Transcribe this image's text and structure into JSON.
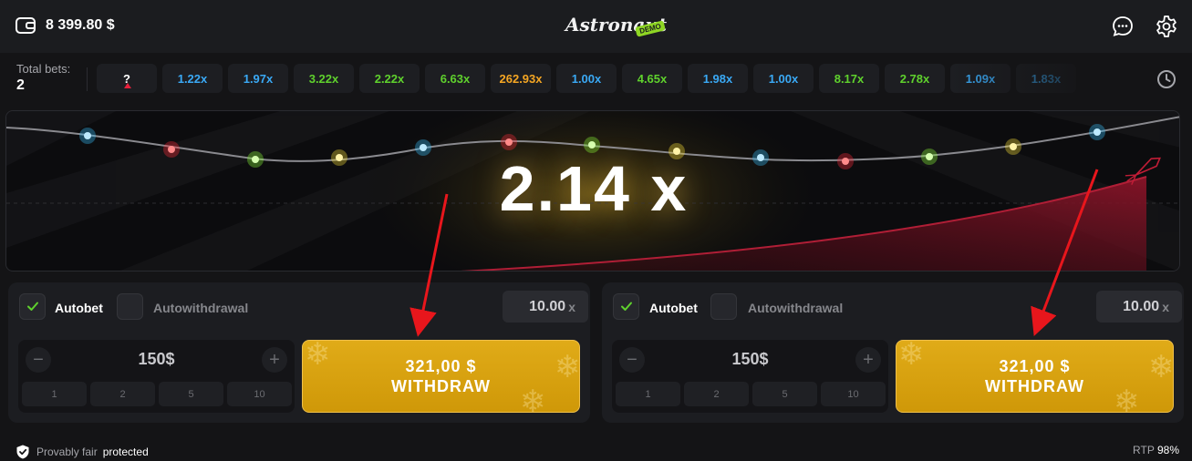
{
  "header": {
    "balance": "8 399.80 $",
    "logo_text": "Astronaut",
    "demo_badge": "DEMO"
  },
  "history": {
    "total_bets_label": "Total bets:",
    "total_bets_value": "2",
    "current_label": "?",
    "items": [
      {
        "value": "1.22x",
        "color": "#3aa9f5"
      },
      {
        "value": "1.97x",
        "color": "#3aa9f5"
      },
      {
        "value": "3.22x",
        "color": "#5fd12d"
      },
      {
        "value": "2.22x",
        "color": "#5fd12d"
      },
      {
        "value": "6.63x",
        "color": "#5fd12d"
      },
      {
        "value": "262.93x",
        "color": "#f5a623"
      },
      {
        "value": "1.00x",
        "color": "#3aa9f5"
      },
      {
        "value": "4.65x",
        "color": "#5fd12d"
      },
      {
        "value": "1.98x",
        "color": "#3aa9f5"
      },
      {
        "value": "1.00x",
        "color": "#3aa9f5"
      },
      {
        "value": "8.17x",
        "color": "#5fd12d"
      },
      {
        "value": "2.78x",
        "color": "#5fd12d"
      },
      {
        "value": "1.09x",
        "color": "#3aa9f5"
      },
      {
        "value": "1.83x",
        "color": "#3aa9f5"
      }
    ]
  },
  "game": {
    "multiplier": "2.14",
    "multiplier_suffix": "x"
  },
  "panels": [
    {
      "autobet_label": "Autobet",
      "autowithdraw_label": "Autowithdrawal",
      "autobet_checked": true,
      "target_value": "10.00",
      "target_suffix": "x",
      "amount": "150$",
      "minus": "−",
      "plus": "+",
      "quick": [
        "1",
        "2",
        "5",
        "10"
      ],
      "withdraw_amount": "321,00 $",
      "withdraw_label": "WITHDRAW"
    },
    {
      "autobet_label": "Autobet",
      "autowithdraw_label": "Autowithdrawal",
      "autobet_checked": true,
      "target_value": "10.00",
      "target_suffix": "x",
      "amount": "150$",
      "minus": "−",
      "plus": "+",
      "quick": [
        "1",
        "2",
        "5",
        "10"
      ],
      "withdraw_amount": "321,00 $",
      "withdraw_label": "WITHDRAW"
    }
  ],
  "footer": {
    "provably_fair": "Provably fair",
    "protected": "protected",
    "rtp_label": "RTP",
    "rtp_value": "98%"
  },
  "colors": {
    "accent_gold": "#d9a410",
    "check_green": "#5fd12d",
    "curve_red": "#7a0f22"
  }
}
